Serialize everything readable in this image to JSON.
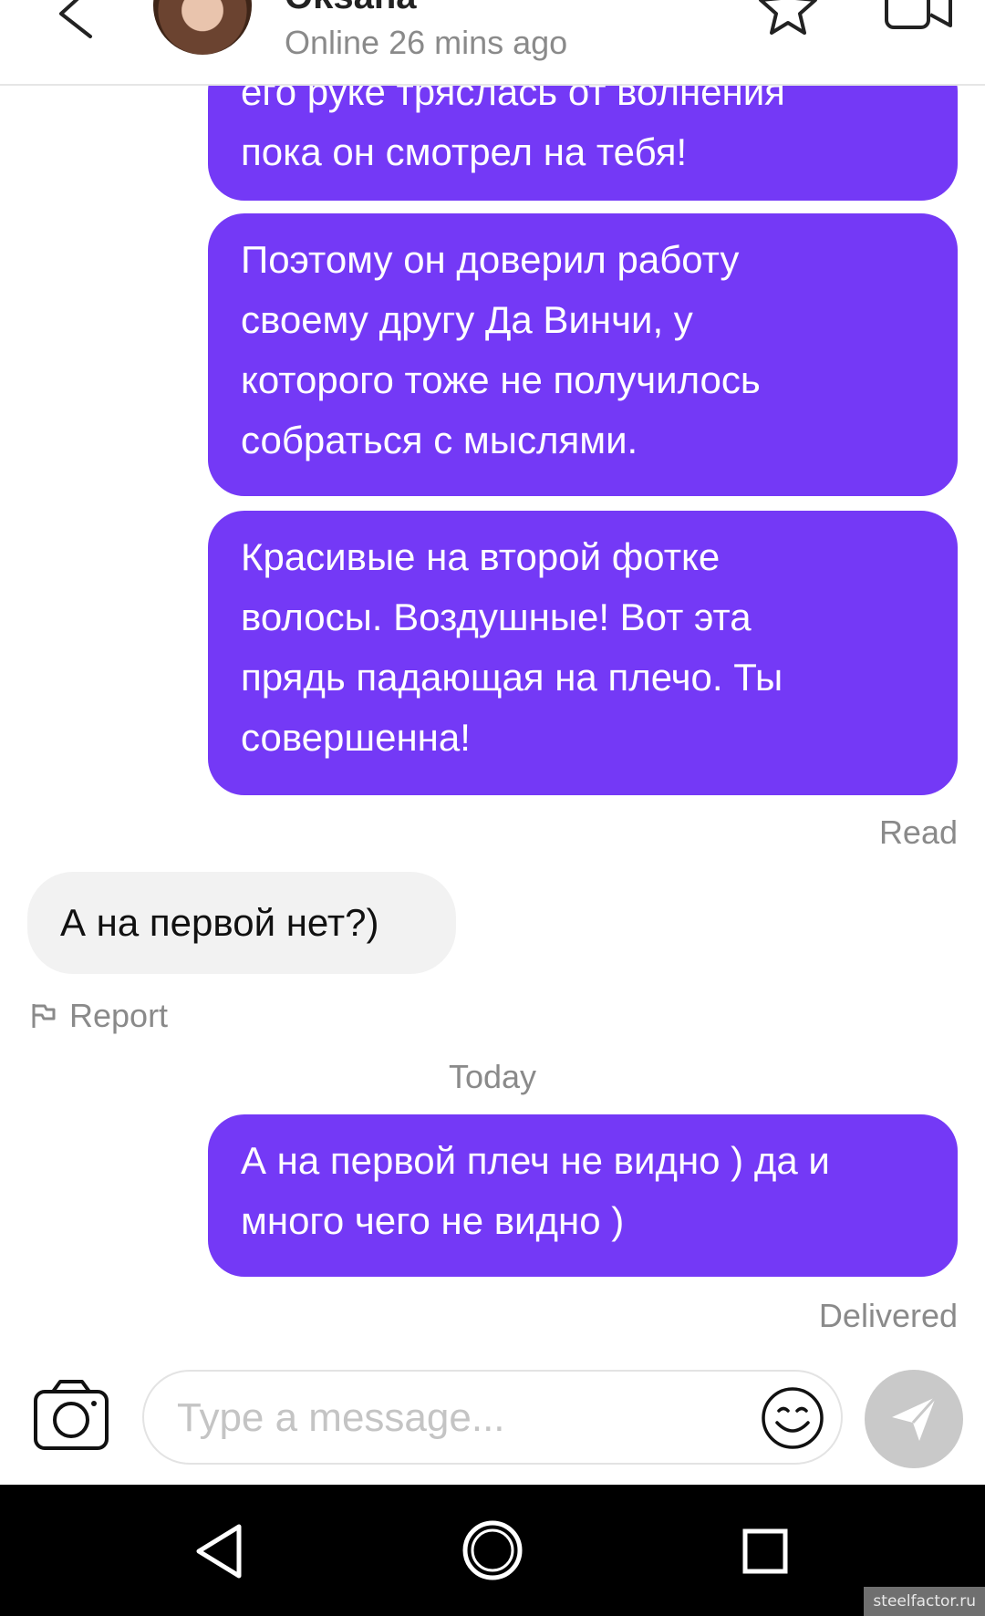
{
  "header": {
    "contact_name": "Oksana",
    "status": "Online 26 mins ago"
  },
  "messages": [
    {
      "direction": "outgoing",
      "lines": [
        "его руке тряслась от волнения",
        "пока он смотрел на тебя!"
      ]
    },
    {
      "direction": "outgoing",
      "lines": [
        "Поэтому он доверил работу",
        "своему другу Да Винчи, у",
        "которого тоже не получилось",
        "собраться с мыслями."
      ]
    },
    {
      "direction": "outgoing",
      "lines": [
        "Красивые на второй фотке",
        "волосы. Воздушные! Вот эта",
        "прядь падающая на плечо. Ты",
        "совершенна!"
      ]
    },
    {
      "direction": "outgoing_status",
      "text": "Read"
    },
    {
      "direction": "incoming",
      "lines": [
        "А на первой нет?)"
      ]
    },
    {
      "direction": "incoming_action",
      "text": "Report"
    },
    {
      "direction": "date_separator",
      "text": "Today"
    },
    {
      "direction": "outgoing",
      "lines": [
        "А на первой плеч не видно ) да и",
        "много чего не видно )"
      ]
    },
    {
      "direction": "outgoing_status",
      "text": "Delivered"
    }
  ],
  "composer": {
    "placeholder": "Type a message..."
  },
  "icons": {
    "back": "chevron-left-icon",
    "favorite": "star-icon",
    "video": "video-camera-icon",
    "camera": "camera-icon",
    "emoji": "smiley-icon",
    "send": "send-icon",
    "report": "flag-icon"
  },
  "colors": {
    "outgoing_bubble": "#7439f6",
    "incoming_bubble": "#f2f2f2",
    "send_button": "#c9c9c9"
  },
  "watermark": "steelfactor.ru"
}
